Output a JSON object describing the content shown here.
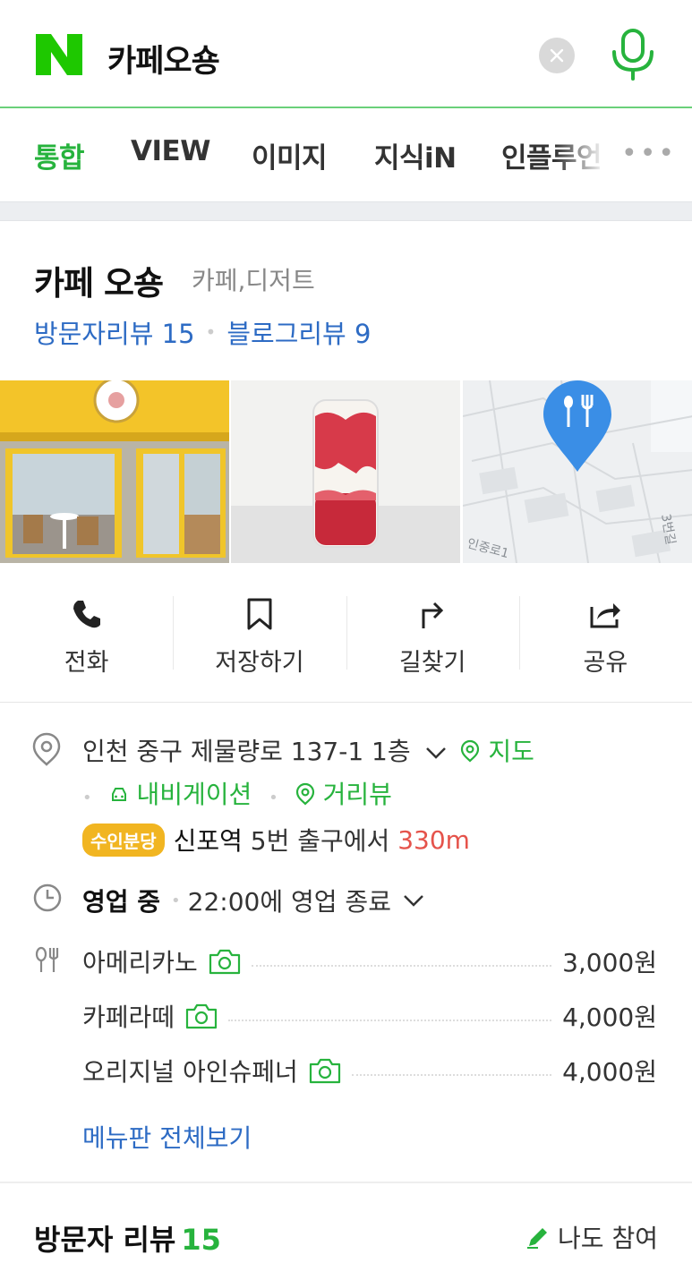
{
  "search": {
    "query": "카페오숑"
  },
  "tabs": [
    {
      "label": "통합",
      "active": true
    },
    {
      "label": "VIEW",
      "active": false
    },
    {
      "label": "이미지",
      "active": false
    },
    {
      "label": "지식iN",
      "active": false
    },
    {
      "label": "인플루언",
      "active": false
    }
  ],
  "place": {
    "name": "카페 오숑",
    "category": "카페,디저트",
    "visitor_reviews_label": "방문자리뷰",
    "visitor_reviews_count": "15",
    "blog_reviews_label": "블로그리뷰",
    "blog_reviews_count": "9"
  },
  "actions": [
    {
      "label": "전화",
      "icon": "phone-icon"
    },
    {
      "label": "저장하기",
      "icon": "bookmark-icon"
    },
    {
      "label": "길찾기",
      "icon": "directions-icon"
    },
    {
      "label": "공유",
      "icon": "share-icon"
    }
  ],
  "info": {
    "address": "인천 중구 제물량로 137-1 1층",
    "map_link": "지도",
    "navigation_link": "내비게이션",
    "street_view_link": "거리뷰",
    "subway_line": "수인분당",
    "subway_station": "신포역",
    "subway_exit": "5번 출구에서",
    "subway_distance": "330m",
    "status": "영업 중",
    "closing": "22:00에 영업 종료"
  },
  "menu": [
    {
      "name": "아메리카노",
      "price": "3,000원"
    },
    {
      "name": "카페라떼",
      "price": "4,000원"
    },
    {
      "name": "오리지널 아인슈페너",
      "price": "4,000원"
    }
  ],
  "menu_all_link": "메뉴판 전체보기",
  "review_section": {
    "title": "방문자 리뷰",
    "count": "15",
    "join_label": "나도 참여"
  },
  "colors": {
    "naver_green": "#27b33d",
    "link_blue": "#2d6bc4",
    "distance_red": "#e5534b",
    "subway_badge": "#f1b521",
    "map_pin_blue": "#3a8ee6"
  }
}
